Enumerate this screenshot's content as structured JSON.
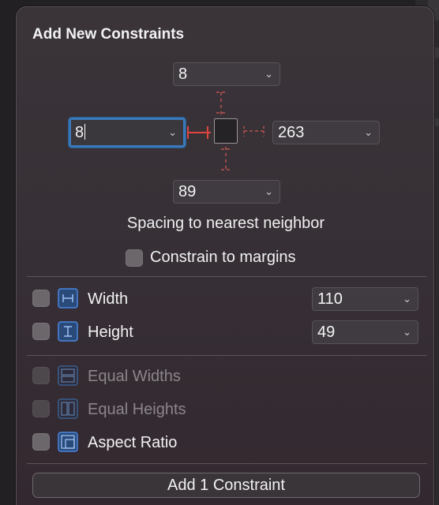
{
  "title": "Add New Constraints",
  "spacing": {
    "top": "8",
    "leading": "8",
    "trailing": "263",
    "bottom": "89",
    "label": "Spacing to nearest neighbor"
  },
  "margins": {
    "label": "Constrain to margins",
    "checked": false
  },
  "sizes": [
    {
      "label": "Width",
      "value": "110",
      "icon": "width-icon",
      "enabled": true
    },
    {
      "label": "Height",
      "value": "49",
      "icon": "height-icon",
      "enabled": true
    }
  ],
  "equal": [
    {
      "label": "Equal Widths",
      "icon": "equal-widths-icon",
      "enabled": false
    },
    {
      "label": "Equal Heights",
      "icon": "equal-heights-icon",
      "enabled": false
    },
    {
      "label": "Aspect Ratio",
      "icon": "aspect-ratio-icon",
      "enabled": true
    }
  ],
  "add_button": "Add 1 Constraint",
  "colors": {
    "accent": "#3a78b8",
    "constraint_active": "#e0443e",
    "constraint_inactive": "#b8524f",
    "icon_blue": "#4a86e0"
  }
}
